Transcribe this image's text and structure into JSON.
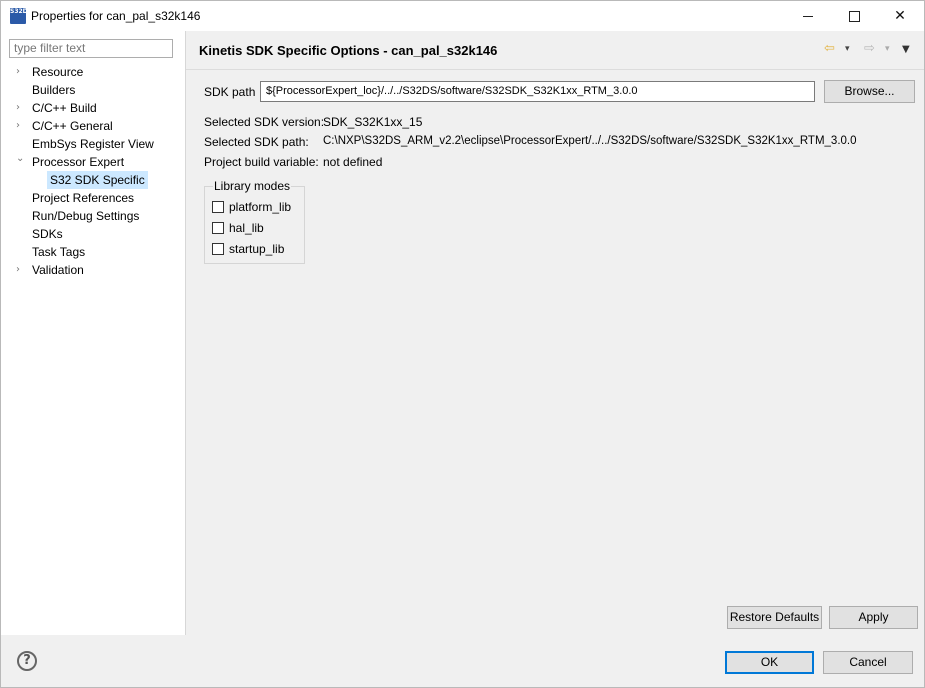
{
  "window": {
    "title": "Properties for can_pal_s32k146",
    "app_icon_text": "S32DS",
    "buttons": {
      "close": "✕"
    }
  },
  "sidebar": {
    "filter_placeholder": "type filter text",
    "items": [
      {
        "label": "Resource",
        "arrow": "›"
      },
      {
        "label": "Builders",
        "arrow": ""
      },
      {
        "label": "C/C++ Build",
        "arrow": "›"
      },
      {
        "label": "C/C++ General",
        "arrow": "›"
      },
      {
        "label": "EmbSys Register View",
        "arrow": ""
      },
      {
        "label": "Processor Expert",
        "arrow": "⌄"
      },
      {
        "label": "S32 SDK Specific",
        "arrow": ""
      },
      {
        "label": "Project References",
        "arrow": ""
      },
      {
        "label": "Run/Debug Settings",
        "arrow": ""
      },
      {
        "label": "SDKs",
        "arrow": ""
      },
      {
        "label": "Task Tags",
        "arrow": ""
      },
      {
        "label": "Validation",
        "arrow": "›"
      }
    ]
  },
  "page": {
    "title": "Kinetis SDK Specific Options - can_pal_s32k146",
    "nav": {
      "back": "⇦",
      "forward": "⇨",
      "dropdown": "▾",
      "menu": "▼"
    },
    "sdk_path_label": "SDK path",
    "sdk_path_value": "${ProcessorExpert_loc}/../../S32DS/software/S32SDK_S32K1xx_RTM_3.0.0",
    "browse_label": "Browse...",
    "selected_sdk_version_label": "Selected SDK version:",
    "selected_sdk_version_value": "SDK_S32K1xx_15",
    "selected_sdk_path_label": "Selected SDK path:",
    "selected_sdk_path_value": "C:\\NXP\\S32DS_ARM_v2.2\\eclipse\\ProcessorExpert/../../S32DS/software/S32SDK_S32K1xx_RTM_3.0.0",
    "project_build_variable_label": "Project build variable:",
    "project_build_variable_value": "not defined",
    "library_modes": {
      "title": "Library modes",
      "options": [
        {
          "label": "platform_lib",
          "checked": false
        },
        {
          "label": "hal_lib",
          "checked": false
        },
        {
          "label": "startup_lib",
          "checked": false
        }
      ]
    },
    "restore_defaults_label": "Restore Defaults",
    "apply_label": "Apply"
  },
  "footer": {
    "help_icon": "?",
    "ok_label": "OK",
    "cancel_label": "Cancel"
  }
}
